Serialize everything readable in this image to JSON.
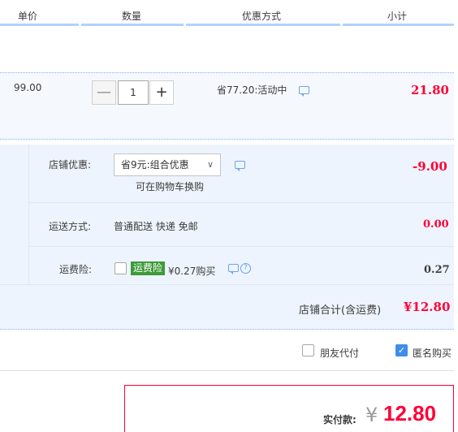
{
  "header": {
    "col_unit_price": "单价",
    "col_quantity": "数量",
    "col_discount": "优惠方式",
    "col_subtotal": "小计"
  },
  "product": {
    "unit_price": "99.00",
    "quantity": "1",
    "minus": "—",
    "plus": "+",
    "discount_text": "省77.20:活动中",
    "subtotal": "21.80"
  },
  "shop": {
    "coupon_label": "店铺优惠:",
    "coupon_select_value": "省9元:组合优惠",
    "coupon_hint": "可在购物车换购",
    "coupon_amount": "-9.00",
    "shipping_label": "运送方式:",
    "shipping_value": "普通配送 快递 免邮",
    "shipping_amount": "0.00",
    "insurance_label": "运费险:",
    "insurance_badge": "运费险",
    "insurance_price": "¥0.27购买",
    "insurance_amount": "0.27",
    "total_label": "店铺合计(含运费)",
    "total_amount": "¥12.80"
  },
  "options": {
    "friend_pay": "朋友代付",
    "anonymous": "匿名购买"
  },
  "payment": {
    "label": "实付款:",
    "currency": "¥",
    "amount": "12.80"
  },
  "colors": {
    "accent_red": "#ff0036",
    "accent_blue": "#3d8ee8",
    "badge_green": "#3d9a3a"
  }
}
